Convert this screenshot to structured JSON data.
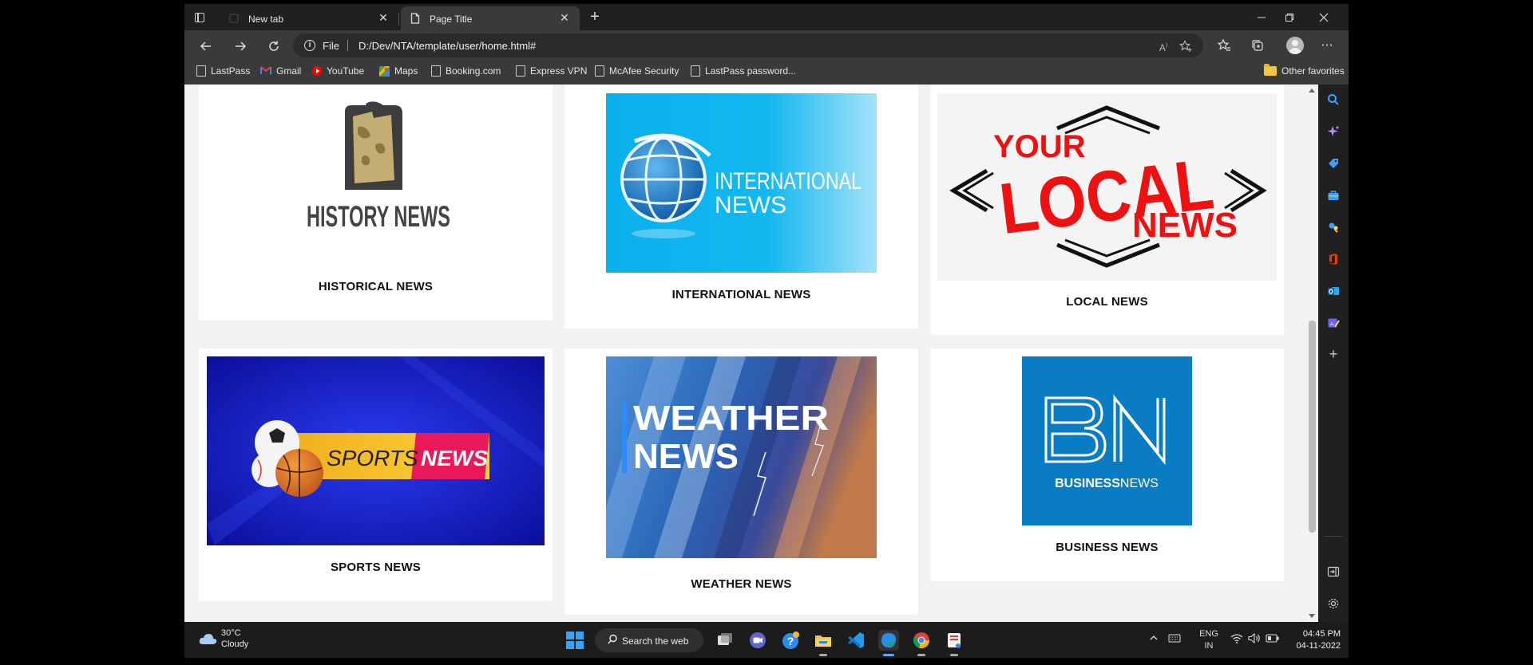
{
  "browser": {
    "tabs": [
      {
        "label": "New tab",
        "active": false
      },
      {
        "label": "Page Title",
        "active": true
      }
    ],
    "address": {
      "scheme": "File",
      "url": "D:/Dev/NTA/template/user/home.html#"
    },
    "favorites": [
      {
        "label": "LastPass",
        "icon": "page-icon"
      },
      {
        "label": "Gmail",
        "icon": "gmail-icon"
      },
      {
        "label": "YouTube",
        "icon": "youtube-icon"
      },
      {
        "label": "Maps",
        "icon": "maps-icon"
      },
      {
        "label": "Booking.com",
        "icon": "page-icon"
      },
      {
        "label": "Express VPN",
        "icon": "page-icon"
      },
      {
        "label": "McAfee Security",
        "icon": "page-icon"
      },
      {
        "label": "LastPass password...",
        "icon": "page-icon"
      }
    ],
    "other_favorites": "Other favorites"
  },
  "page": {
    "cards": [
      {
        "title": "HISTORICAL NEWS",
        "logo_text": "HISTORY NEWS"
      },
      {
        "title": "INTERNATIONAL NEWS",
        "logo_line1": "INTERNATIONAL",
        "logo_line2": "NEWS"
      },
      {
        "title": "LOCAL NEWS",
        "logo_your": "YOUR",
        "logo_local": "LOCAL",
        "logo_news": "NEWS"
      },
      {
        "title": "SPORTS NEWS",
        "logo_sports": "SPORTS",
        "logo_news": "NEWS"
      },
      {
        "title": "WEATHER NEWS",
        "logo_line1": "WEATHER",
        "logo_line2": "NEWS"
      },
      {
        "title": "BUSINESS NEWS",
        "logo_mark": "BN",
        "logo_bold": "BUSINESS",
        "logo_light": "NEWS"
      }
    ]
  },
  "taskbar": {
    "weather": {
      "temp": "30°C",
      "condition": "Cloudy"
    },
    "search_label": "Search the web",
    "language": {
      "code": "ENG",
      "region": "IN"
    },
    "time": "04:45 PM",
    "date": "04-11-2022"
  },
  "colors": {
    "accent": "#0078d4",
    "local_red": "#ee1111",
    "business_blue": "#0a7cc4",
    "sports_yellow": "#f7c531",
    "sports_pink": "#e8185a"
  }
}
